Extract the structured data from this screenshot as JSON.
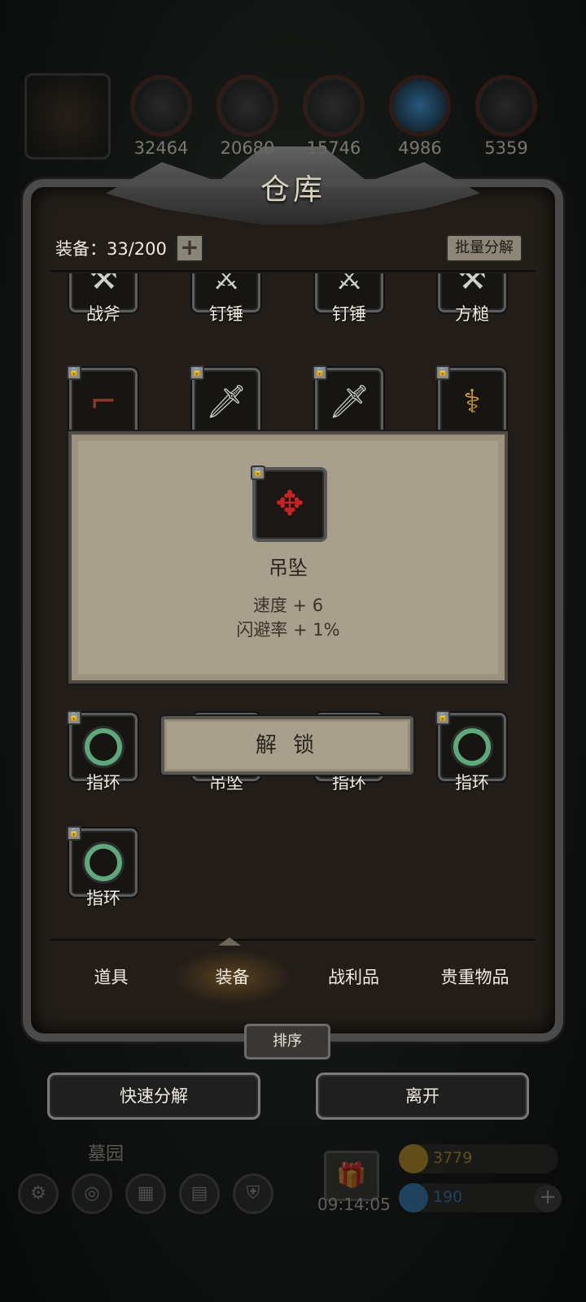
{
  "resources": [
    {
      "icon": "leather-icon",
      "amount": "32464"
    },
    {
      "icon": "wood-icon",
      "amount": "20680"
    },
    {
      "icon": "iron-icon",
      "amount": "15746"
    },
    {
      "icon": "crystal-icon",
      "amount": "4986"
    },
    {
      "icon": "ore-icon",
      "amount": "5359"
    }
  ],
  "panel": {
    "title": "仓库",
    "equip_count": "装备：33/200",
    "add_label": "+",
    "batch_label": "批量分解"
  },
  "items": [
    {
      "name": "战斧",
      "icon": "battle-axe-icon",
      "locked": false
    },
    {
      "name": "钉锤",
      "icon": "mace-icon",
      "locked": false
    },
    {
      "name": "钉锤",
      "icon": "mace-icon",
      "locked": false
    },
    {
      "name": "方槌",
      "icon": "hammer-icon",
      "locked": false
    },
    {
      "name": "",
      "icon": "pistol-icon",
      "locked": true
    },
    {
      "name": "",
      "icon": "dagger-icon",
      "locked": true
    },
    {
      "name": "",
      "icon": "dagger-icon",
      "locked": true
    },
    {
      "name": "",
      "icon": "staff-icon",
      "locked": true
    },
    {
      "name": "指环",
      "icon": "ring-icon",
      "locked": true
    },
    {
      "name": "吊坠",
      "icon": "pendant-icon",
      "locked": false
    },
    {
      "name": "指环",
      "icon": "ring-icon",
      "locked": false
    },
    {
      "name": "指环",
      "icon": "ring-icon",
      "locked": true
    },
    {
      "name": "指环",
      "icon": "ring-icon",
      "locked": true
    }
  ],
  "tooltip": {
    "name": "吊坠",
    "icon": "pendant-icon",
    "stats": [
      "速度 + 6",
      "闪避率 + 1%"
    ],
    "unlock_label": "解 锁"
  },
  "tabs": [
    {
      "label": "道具",
      "active": false
    },
    {
      "label": "装备",
      "active": true
    },
    {
      "label": "战利品",
      "active": false
    },
    {
      "label": "贵重物品",
      "active": false
    }
  ],
  "sort_label": "排序",
  "actions": {
    "quick_decompose": "快速分解",
    "leave": "离开"
  },
  "background_hud": {
    "location": "墓园",
    "timer": "09:14:05",
    "gold": "3779",
    "gems": "190"
  },
  "colors": {
    "gold": "#e0a82a",
    "gem": "#3a8fd4",
    "tooltip_bg": "#a89f8d",
    "ring_band": "#5fa87c"
  }
}
